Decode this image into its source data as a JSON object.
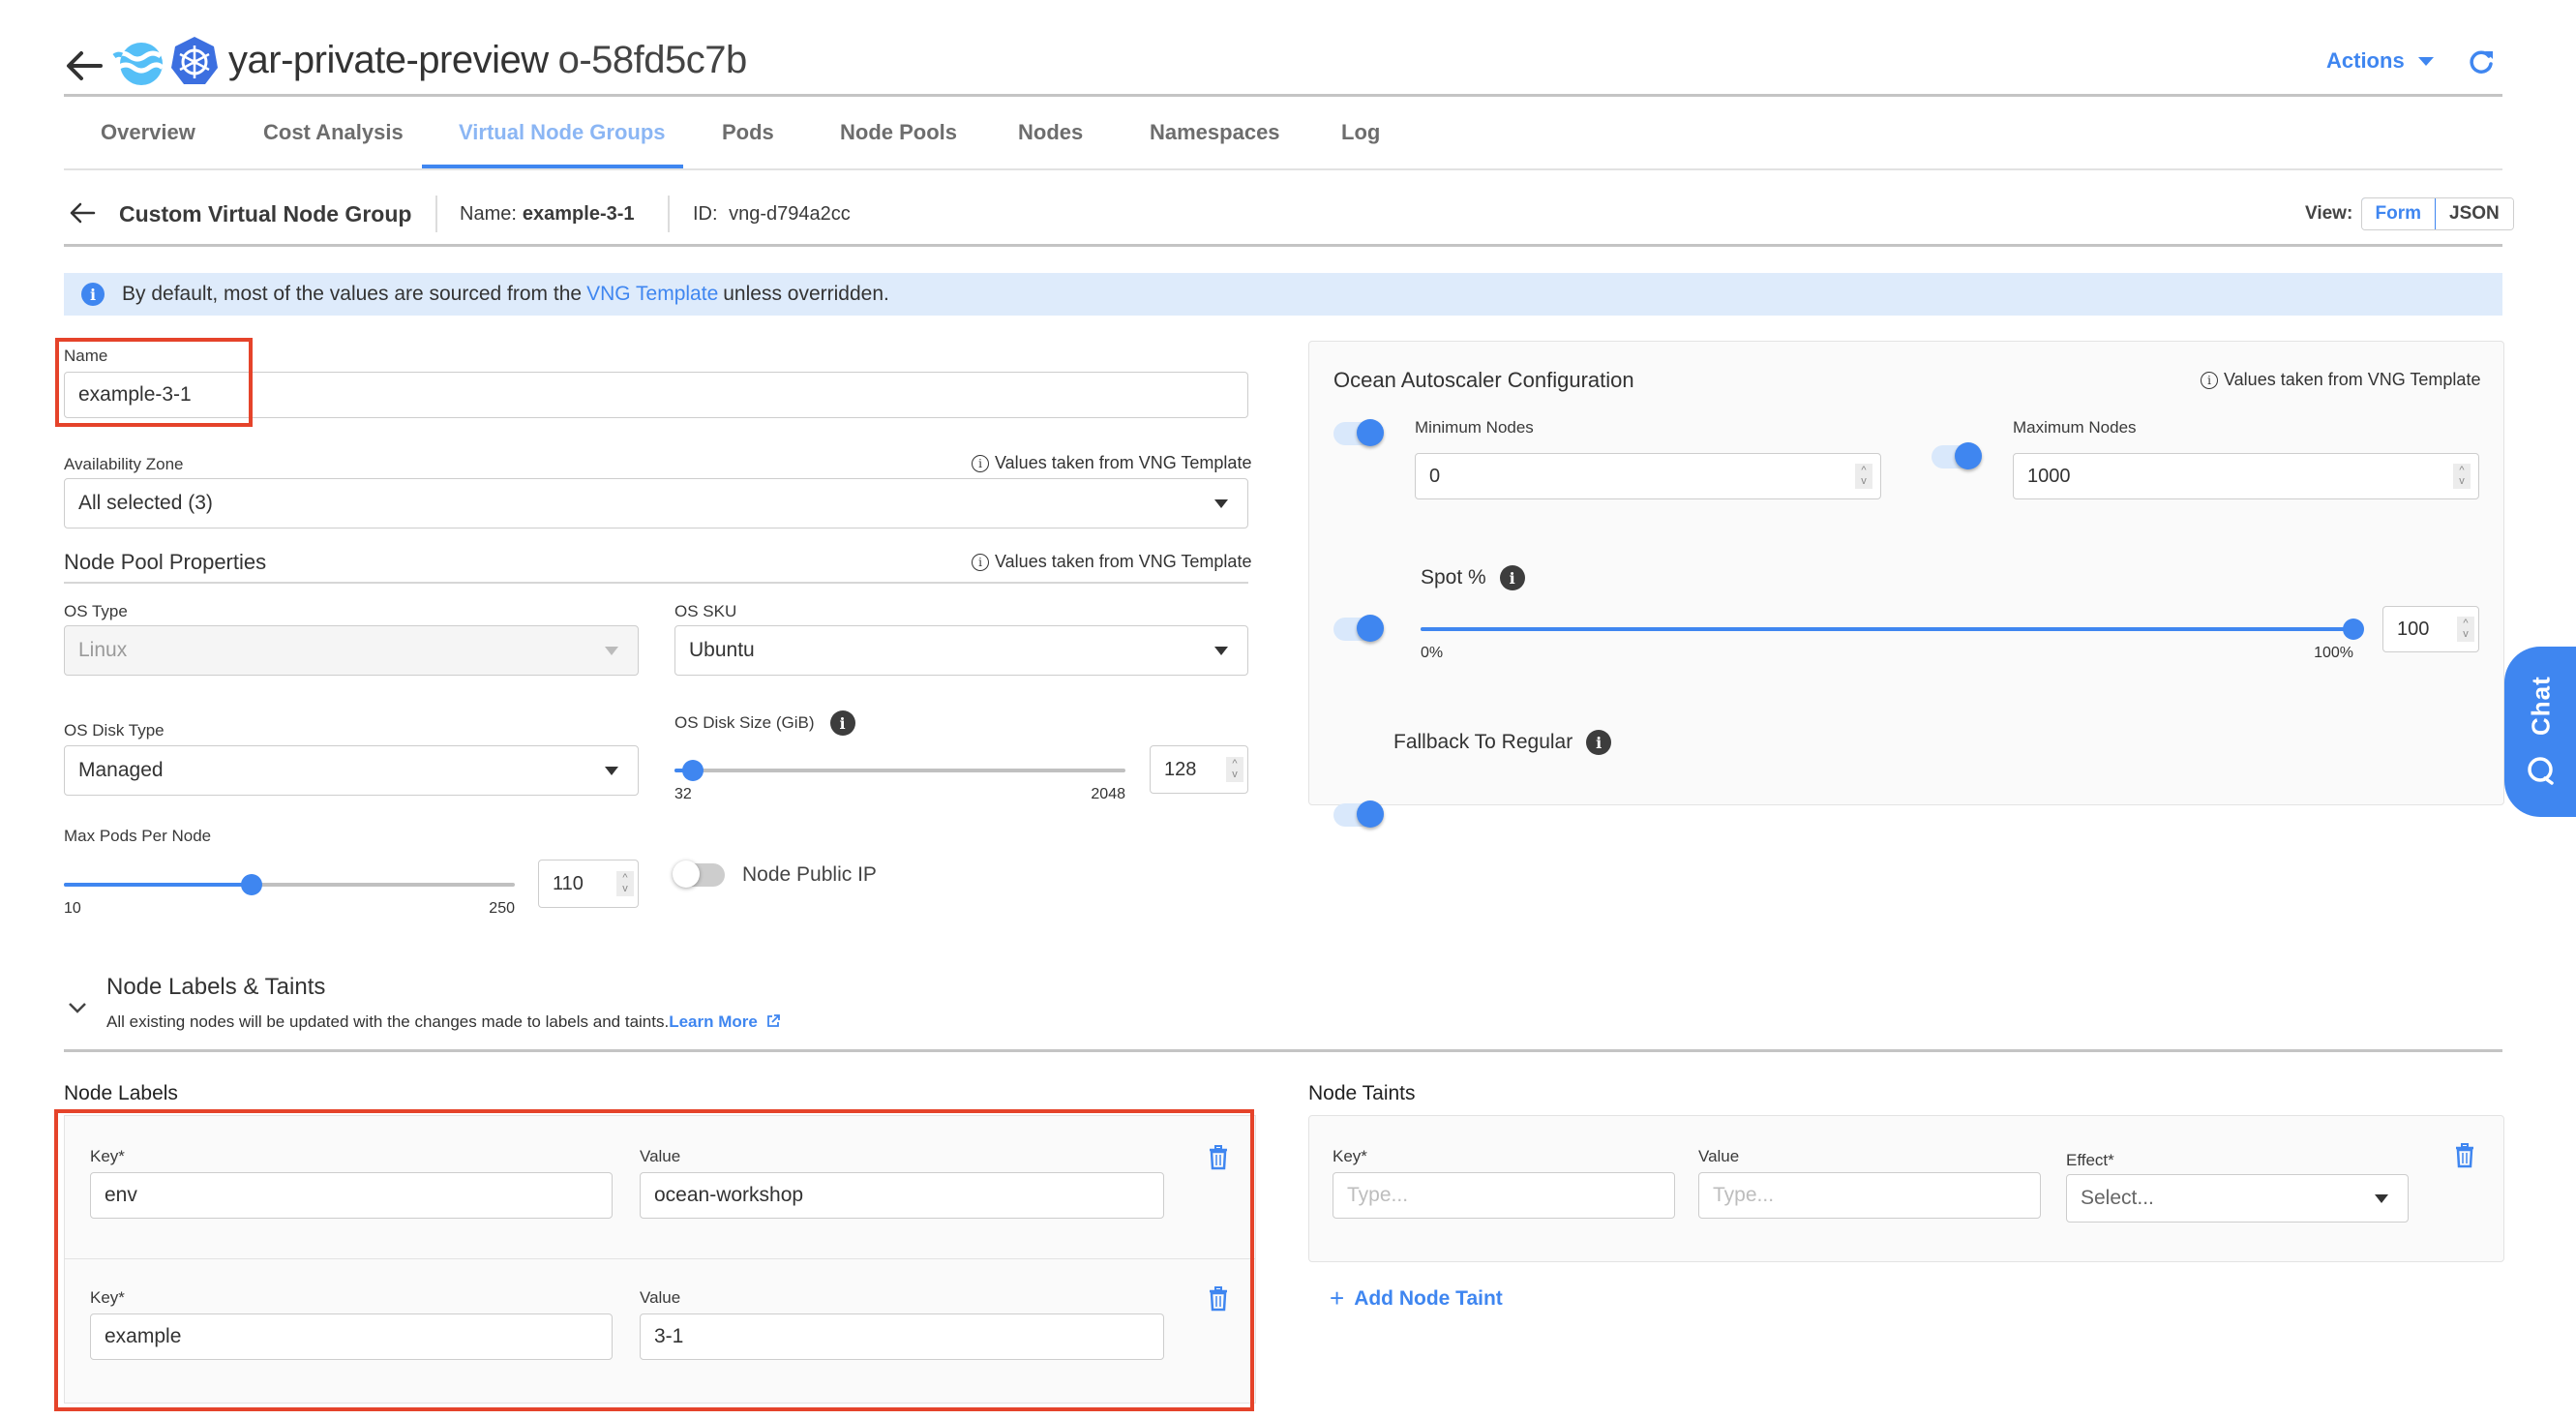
{
  "header": {
    "title": "yar-private-preview",
    "cluster_id": "o-58fd5c7b",
    "actions_label": "Actions",
    "icons": {
      "back": "arrow-left-icon",
      "ocean_logo": "ocean-logo-icon",
      "k8s_logo": "kubernetes-logo-icon",
      "refresh": "refresh-icon"
    }
  },
  "tabs": [
    {
      "label": "Overview",
      "active": false
    },
    {
      "label": "Cost Analysis",
      "active": false
    },
    {
      "label": "Virtual Node Groups",
      "active": true
    },
    {
      "label": "Pods",
      "active": false
    },
    {
      "label": "Node Pools",
      "active": false
    },
    {
      "label": "Nodes",
      "active": false
    },
    {
      "label": "Namespaces",
      "active": false
    },
    {
      "label": "Log",
      "active": false
    }
  ],
  "subheader": {
    "title": "Custom Virtual Node Group",
    "name_label": "Name:",
    "name_value": "example-3-1",
    "id_label": "ID:",
    "id_value": "vng-d794a2cc",
    "view_label": "View:",
    "view_options": [
      "Form",
      "JSON"
    ],
    "view_selected": "Form"
  },
  "banner": {
    "text_before": "By default, most of the values are sourced from the",
    "link": "VNG Template",
    "text_after": "unless overridden."
  },
  "form": {
    "name_label": "Name",
    "name_value": "example-3-1",
    "az_label": "Availability Zone",
    "az_value": "All selected (3)",
    "template_hint": "Values taken from VNG Template",
    "node_pool_title": "Node Pool Properties",
    "os_type_label": "OS Type",
    "os_type_value": "Linux",
    "os_sku_label": "OS SKU",
    "os_sku_value": "Ubuntu",
    "os_disk_type_label": "OS Disk Type",
    "os_disk_type_value": "Managed",
    "os_disk_size_label": "OS Disk Size (GiB)",
    "os_disk_size": {
      "min": 32,
      "max": 2048,
      "value": 128,
      "min_label": "32",
      "max_label": "2048",
      "value_label": "128"
    },
    "max_pods_label": "Max Pods Per Node",
    "max_pods": {
      "min": 10,
      "max": 250,
      "value": 110,
      "min_label": "10",
      "max_label": "250",
      "value_label": "110"
    },
    "node_public_ip_label": "Node Public IP",
    "node_public_ip_enabled": false
  },
  "autoscaler": {
    "title": "Ocean Autoscaler Configuration",
    "hint": "Values taken from VNG Template",
    "min_nodes_label": "Minimum Nodes",
    "min_nodes_value": "0",
    "min_nodes_enabled": true,
    "max_nodes_label": "Maximum Nodes",
    "max_nodes_value": "1000",
    "max_nodes_enabled": true,
    "spot_label": "Spot %",
    "spot_enabled": true,
    "spot": {
      "min": 0,
      "max": 100,
      "value": 100,
      "min_label": "0%",
      "max_label": "100%",
      "value_label": "100"
    },
    "fallback_label": "Fallback To Regular",
    "fallback_enabled": true
  },
  "labels_taints": {
    "title": "Node Labels & Taints",
    "description": "All existing nodes will be updated with the changes made to labels and taints.",
    "learn_more": "Learn More",
    "node_labels_title": "Node Labels",
    "key_label": "Key*",
    "value_label": "Value",
    "labels": [
      {
        "key": "env",
        "value": "ocean-workshop"
      },
      {
        "key": "example",
        "value": "3-1"
      }
    ],
    "node_taints_title": "Node Taints",
    "effect_label": "Effect*",
    "taint_key_placeholder": "Type...",
    "taint_value_placeholder": "Type...",
    "taint_effect_placeholder": "Select...",
    "add_taint_label": "Add Node Taint"
  },
  "chat": {
    "label": "Chat"
  },
  "colors": {
    "accent": "#3f86f0",
    "highlight": "#e5432a",
    "banner_bg": "#deebfb"
  }
}
